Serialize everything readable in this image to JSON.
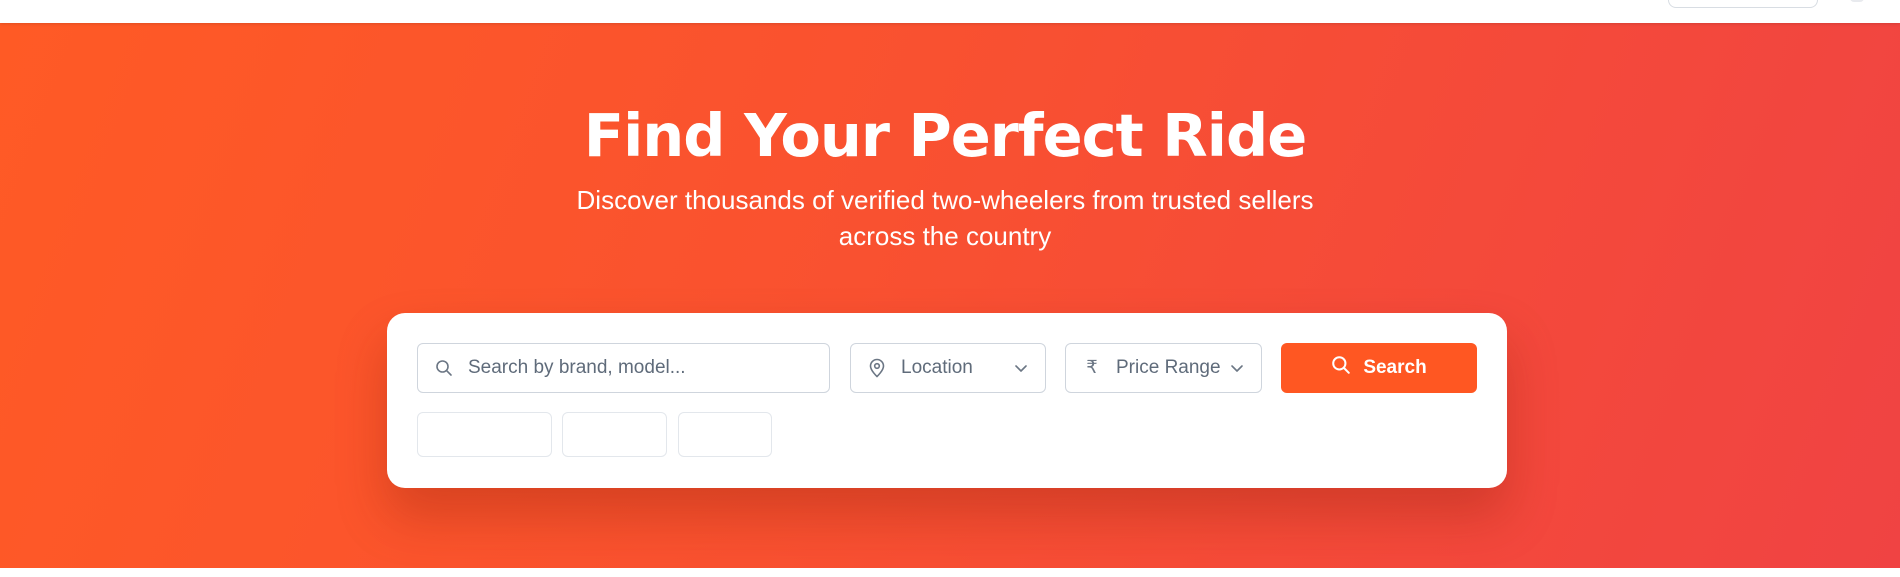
{
  "hero": {
    "title": "Find Your Perfect Ride",
    "subtitle_line1": "Discover thousands of verified two-wheelers from trusted sellers",
    "subtitle_line2": "across the country"
  },
  "search": {
    "placeholder": "Search by brand, model...",
    "location_label": "Location",
    "price_label": "Price Range",
    "button_label": "Search",
    "icons": [
      "search-icon",
      "map-pin-icon",
      "rupee-icon",
      "chevron-down-icon"
    ]
  },
  "quick_filters": [
    "",
    "",
    ""
  ],
  "colors": {
    "hero_gradient_start": "#ff5a25",
    "hero_gradient_end": "#f04343",
    "primary_button": "#ff5722",
    "card_background": "#ffffff"
  }
}
